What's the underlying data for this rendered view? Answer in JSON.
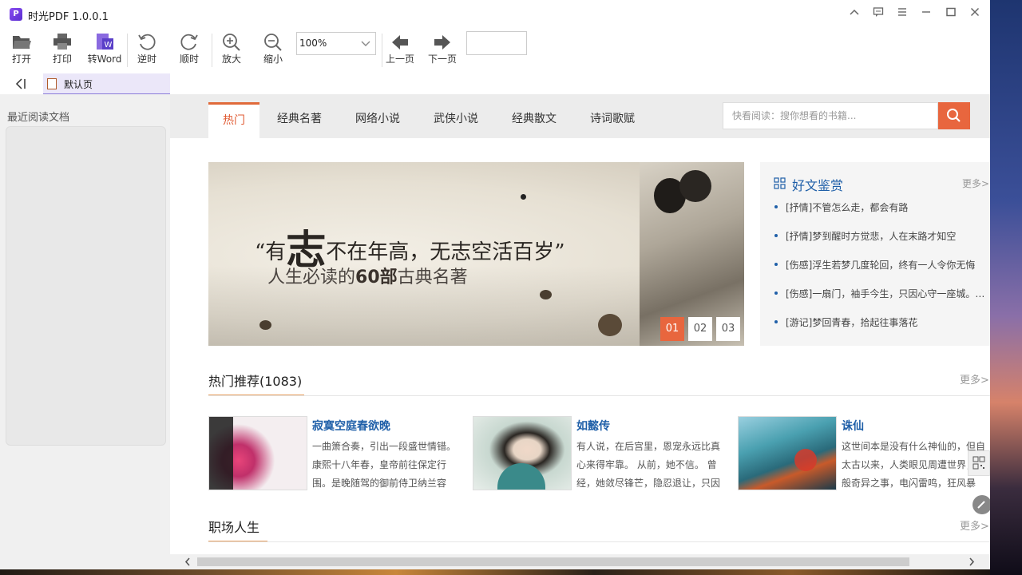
{
  "window": {
    "title": "时光PDF 1.0.0.1"
  },
  "toolbar": {
    "open": "打开",
    "print": "打印",
    "to_word": "转Word",
    "rotate_ccw": "逆时",
    "rotate_cw": "顺时",
    "zoom_in": "放大",
    "zoom_out": "缩小",
    "zoom_value": "100%",
    "prev_page": "上一页",
    "next_page": "下一页",
    "page_value": ""
  },
  "tabs": {
    "default_tab": "默认页"
  },
  "sidebar": {
    "recent_title": "最近阅读文档"
  },
  "web": {
    "nav": [
      "热门",
      "经典名著",
      "网络小说",
      "武侠小说",
      "经典散文",
      "诗词歌赋"
    ],
    "search_placeholder": "快看阅读：搜你想看的书籍...",
    "banner": {
      "quote_open": "“有",
      "quote_big": "志",
      "quote_rest": "不在年高，无志空活百岁”",
      "sub_pre": "人生必读的",
      "sub_bold": "60部",
      "sub_post": "古典名著",
      "pagers": [
        "01",
        "02",
        "03"
      ]
    },
    "side": {
      "title": "好文鉴赏",
      "more": "更多>",
      "items": [
        "[抒情]不管怎么走，都会有路",
        "[抒情]梦到醒时方觉悲，人在末路才知空",
        "[伤感]浮生若梦几度轮回，终有一人令你无悔",
        "[伤感]一扇门，袖手今生，只因心守一座城。一...",
        "[游记]梦回青春，拾起往事落花"
      ]
    },
    "hot": {
      "title": "热门推荐(1083)",
      "more": "更多>",
      "books": [
        {
          "title": "寂寞空庭春欲晚",
          "desc": "一曲箫合奏，引出一段盛世情错。康熙十八年春，皇帝前往保定行围。是晚随驾的御前侍卫纳兰容"
        },
        {
          "title": "如懿传",
          "desc": "有人说，在后宫里，恩宠永远比真心来得牢靠。 从前，她不信。 曾经，她敛尽锋芒，隐忍退让，只因"
        },
        {
          "title": "诛仙",
          "desc": "这世间本是没有什么神仙的，但自太古以来，人类眼见周遭世界，诸般奇异之事，电闪雷鸣，狂风暴"
        }
      ]
    },
    "career": {
      "title": "职场人生",
      "more": "更多>"
    }
  }
}
